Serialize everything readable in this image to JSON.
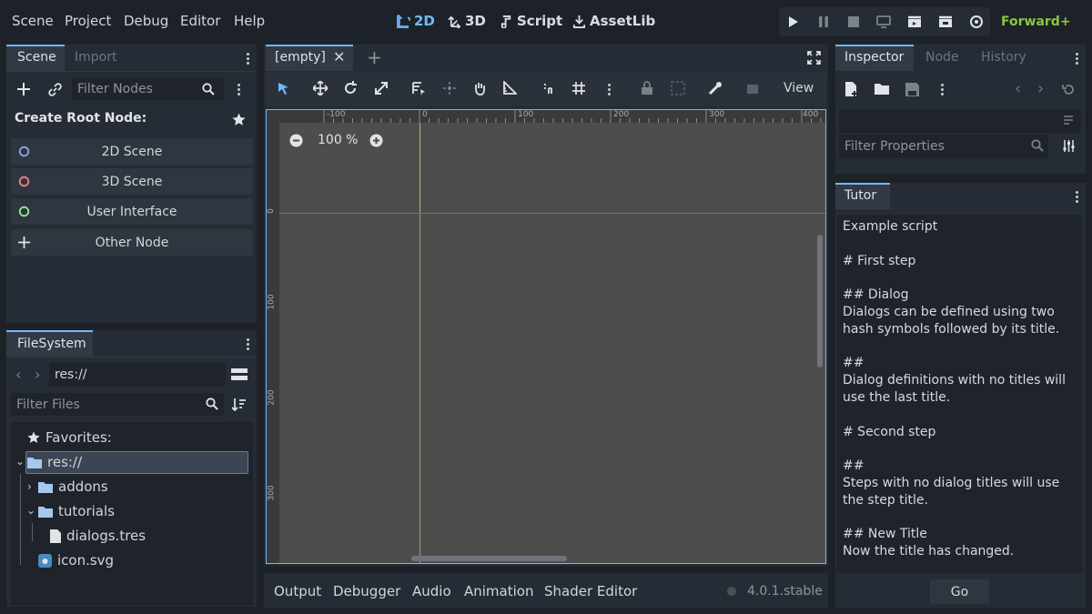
{
  "menu": [
    "Scene",
    "Project",
    "Debug",
    "Editor",
    "Help"
  ],
  "workspaces": [
    {
      "label": "2D",
      "icon": "2d-icon",
      "active": true
    },
    {
      "label": "3D",
      "icon": "3d-icon",
      "active": false
    },
    {
      "label": "Script",
      "icon": "script-icon",
      "active": false
    },
    {
      "label": "AssetLib",
      "icon": "assetlib-icon",
      "active": false
    }
  ],
  "renderer": "Forward+",
  "scene_dock": {
    "tabs": [
      "Scene",
      "Import"
    ],
    "filter_placeholder": "Filter Nodes",
    "create_root_label": "Create Root Node:",
    "root_options": [
      {
        "label": "2D Scene",
        "icon": "node2d-icon",
        "color": "#8da5f3"
      },
      {
        "label": "3D Scene",
        "icon": "node3d-icon",
        "color": "#fc7f7f"
      },
      {
        "label": "User Interface",
        "icon": "control-icon",
        "color": "#8eef97"
      },
      {
        "label": "Other Node",
        "icon": "add-icon",
        "color": "#e0e0e0"
      }
    ]
  },
  "filesystem": {
    "tab": "FileSystem",
    "path": "res://",
    "filter_placeholder": "Filter Files",
    "favorites_label": "Favorites:",
    "items": [
      {
        "label": "res://",
        "type": "folder",
        "selected": true
      },
      {
        "label": "addons",
        "type": "folder"
      },
      {
        "label": "tutorials",
        "type": "folder"
      },
      {
        "label": "dialogs.tres",
        "type": "file"
      },
      {
        "label": "icon.svg",
        "type": "image"
      }
    ]
  },
  "viewport": {
    "tab_title": "[empty]",
    "view_menu": "View",
    "zoom": "100 %",
    "ruler_h": [
      "-100",
      "0",
      "100",
      "200",
      "300",
      "400"
    ],
    "ruler_v": [
      "0",
      "100",
      "200",
      "300"
    ]
  },
  "bottom_panel": {
    "tabs": [
      "Output",
      "Debugger",
      "Audio",
      "Animation",
      "Shader Editor"
    ],
    "version": "4.0.1.stable"
  },
  "inspector": {
    "tabs": [
      "Inspector",
      "Node",
      "History"
    ],
    "filter_placeholder": "Filter Properties"
  },
  "tutor": {
    "tab": "Tutor",
    "lines": [
      "Example script",
      "",
      "# First step",
      "",
      "## Dialog",
      "Dialogs can be defined using two",
      "hash symbols followed by its title.",
      "",
      "##",
      "Dialog definitions with no titles will",
      "use the last title.",
      "",
      "# Second step",
      "",
      "##",
      "Steps with no dialog titles will use",
      "the step title.",
      "",
      "## New Title",
      "Now the title has changed."
    ],
    "go_label": "Go"
  },
  "colors": {
    "accent": "#70b8ff",
    "renderer": "#8cc63f",
    "panel": "#262c35",
    "background": "#1d2229",
    "canvas": "#4d4d4d"
  }
}
